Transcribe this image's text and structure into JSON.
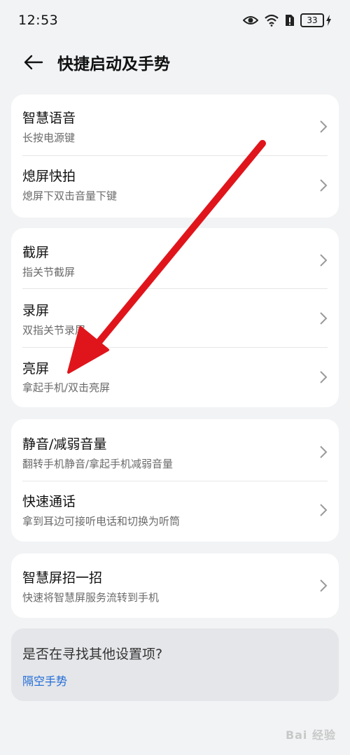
{
  "status_bar": {
    "time": "12:53",
    "battery": "33"
  },
  "header": {
    "title": "快捷启动及手势"
  },
  "groups": [
    {
      "items": [
        {
          "title": "智慧语音",
          "subtitle": "长按电源键"
        },
        {
          "title": "熄屏快拍",
          "subtitle": "熄屏下双击音量下键"
        }
      ]
    },
    {
      "items": [
        {
          "title": "截屏",
          "subtitle": "指关节截屏"
        },
        {
          "title": "录屏",
          "subtitle": "双指关节录屏"
        },
        {
          "title": "亮屏",
          "subtitle": "拿起手机/双击亮屏"
        }
      ]
    },
    {
      "items": [
        {
          "title": "静音/减弱音量",
          "subtitle": "翻转手机静音/拿起手机减弱音量"
        },
        {
          "title": "快速通话",
          "subtitle": "拿到耳边可接听电话和切换为听筒"
        }
      ]
    },
    {
      "items": [
        {
          "title": "智慧屏招一招",
          "subtitle": "快速将智慧屏服务流转到手机"
        }
      ]
    }
  ],
  "hint": {
    "question": "是否在寻找其他设置项?",
    "link": "隔空手势"
  },
  "watermark": "Bai 经验",
  "colors": {
    "background": "#f1f3f5",
    "card": "#ffffff",
    "link": "#1f6ad8",
    "annotation_arrow": "#e0151b"
  }
}
